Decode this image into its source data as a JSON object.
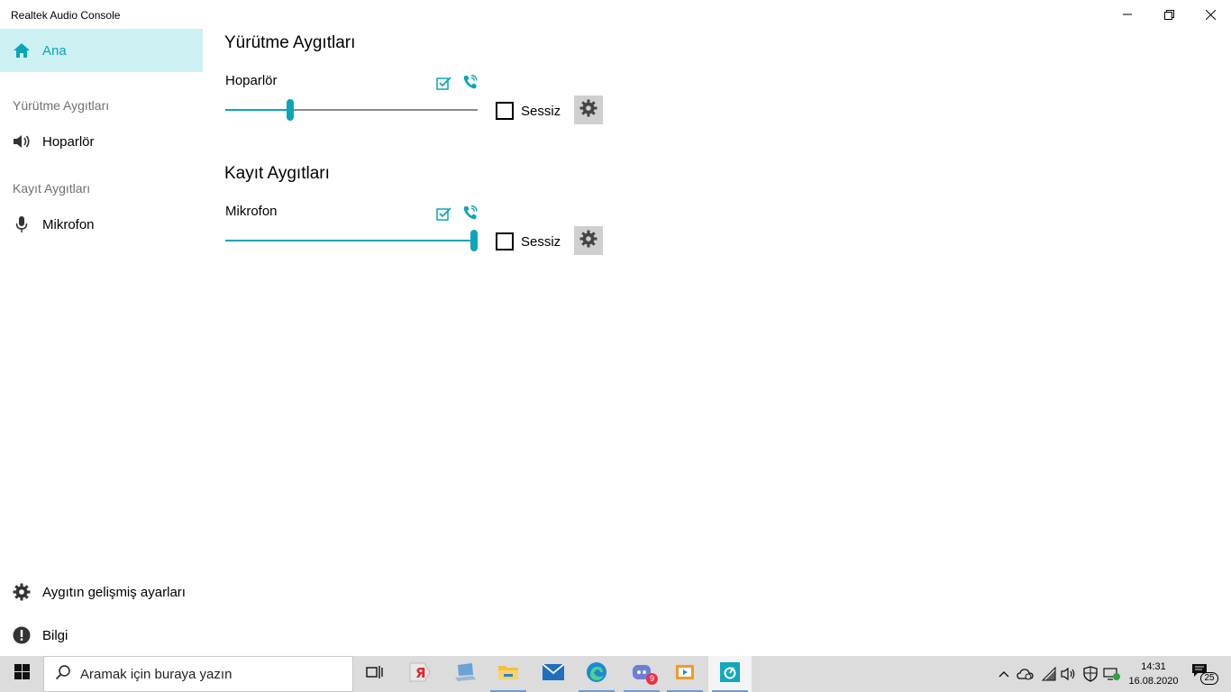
{
  "window": {
    "title": "Realtek Audio Console"
  },
  "sidebar": {
    "home_label": "Ana",
    "playback_section": "Yürütme Aygıtları",
    "playback_item": "Hoparlör",
    "record_section": "Kayıt Aygıtları",
    "record_item": "Mikrofon",
    "advanced_label": "Aygıtın gelişmiş ayarları",
    "info_label": "Bilgi"
  },
  "main": {
    "playback_title": "Yürütme Aygıtları",
    "record_title": "Kayıt Aygıtları",
    "devices": [
      {
        "name": "Hoparlör",
        "volume_percent": 25,
        "mute_label": "Sessiz",
        "muted": false
      },
      {
        "name": "Mikrofon",
        "volume_percent": 100,
        "mute_label": "Sessiz",
        "muted": false
      }
    ]
  },
  "taskbar": {
    "search_placeholder": "Aramak için buraya yazın",
    "discord_badge": "9",
    "clock_time": "14:31",
    "clock_date": "16.08.2020",
    "notification_count": "25"
  },
  "colors": {
    "accent": "#0aa6b8",
    "active_nav_bg": "#cdf0f2",
    "taskbar_bg": "#dcdcdc"
  },
  "icons": [
    "home-icon",
    "speaker-icon",
    "microphone-icon",
    "gear-icon",
    "info-icon",
    "default-device-check-icon",
    "communication-phone-icon",
    "windows-logo-icon",
    "search-icon"
  ]
}
